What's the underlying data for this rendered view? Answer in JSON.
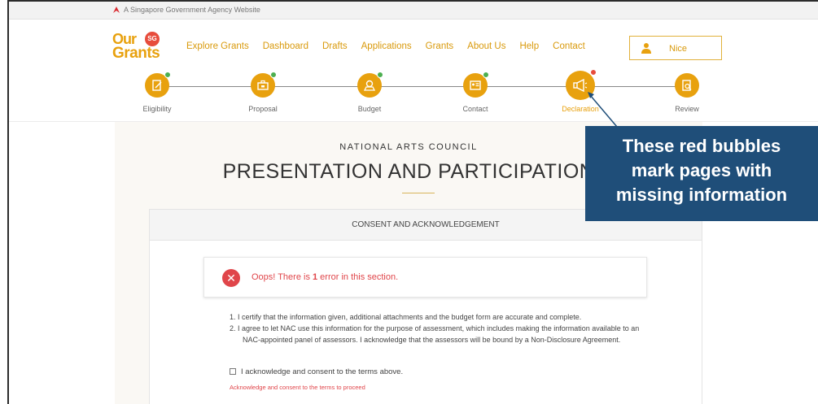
{
  "gov_banner": {
    "text": "A Singapore Government Agency Website"
  },
  "logo": {
    "line1": "Our",
    "line2": "Grants",
    "badge": "SG"
  },
  "nav": {
    "items": [
      {
        "label": "Explore Grants"
      },
      {
        "label": "Dashboard"
      },
      {
        "label": "Drafts"
      },
      {
        "label": "Applications"
      },
      {
        "label": "Grants"
      },
      {
        "label": "About Us"
      },
      {
        "label": "Help"
      },
      {
        "label": "Contact"
      }
    ],
    "user": {
      "name": "Nice",
      "icon": "user-icon"
    }
  },
  "steps": [
    {
      "label": "Eligibility",
      "icon": "eligibility-icon",
      "status": "complete"
    },
    {
      "label": "Proposal",
      "icon": "proposal-icon",
      "status": "complete"
    },
    {
      "label": "Budget",
      "icon": "budget-icon",
      "status": "complete"
    },
    {
      "label": "Contact",
      "icon": "contact-icon",
      "status": "complete"
    },
    {
      "label": "Declaration",
      "icon": "declaration-icon",
      "status": "missing-info"
    },
    {
      "label": "Review",
      "icon": "review-icon",
      "status": "none"
    }
  ],
  "page": {
    "org": "NATIONAL ARTS COUNCIL",
    "title": "PRESENTATION AND PARTICIPATION",
    "section_title": "CONSENT AND ACKNOWLEDGEMENT",
    "error": {
      "prefix": "Oops! There is ",
      "count": "1",
      "suffix": " error in this section."
    },
    "terms": [
      "1. I certify that the information given, additional attachments and the budget form are accurate and complete.",
      "2. I agree to let NAC use this information for the purpose of assessment, which includes making the information available to an NAC-appointed panel of assessors. I acknowledge that the assessors will be bound by a Non-Disclosure Agreement."
    ],
    "consent_label": "I acknowledge and consent to the terms above.",
    "consent_error": "Acknowledge and consent to the terms to proceed"
  },
  "callout": {
    "lines": [
      "These red bubbles",
      "mark pages with",
      "missing information"
    ]
  },
  "colors": {
    "accent": "#e8a10e",
    "complete_dot": "#4caf50",
    "missing_dot": "#e74c3c",
    "error_red": "#e0454a",
    "callout_bg": "#1f4e79"
  }
}
